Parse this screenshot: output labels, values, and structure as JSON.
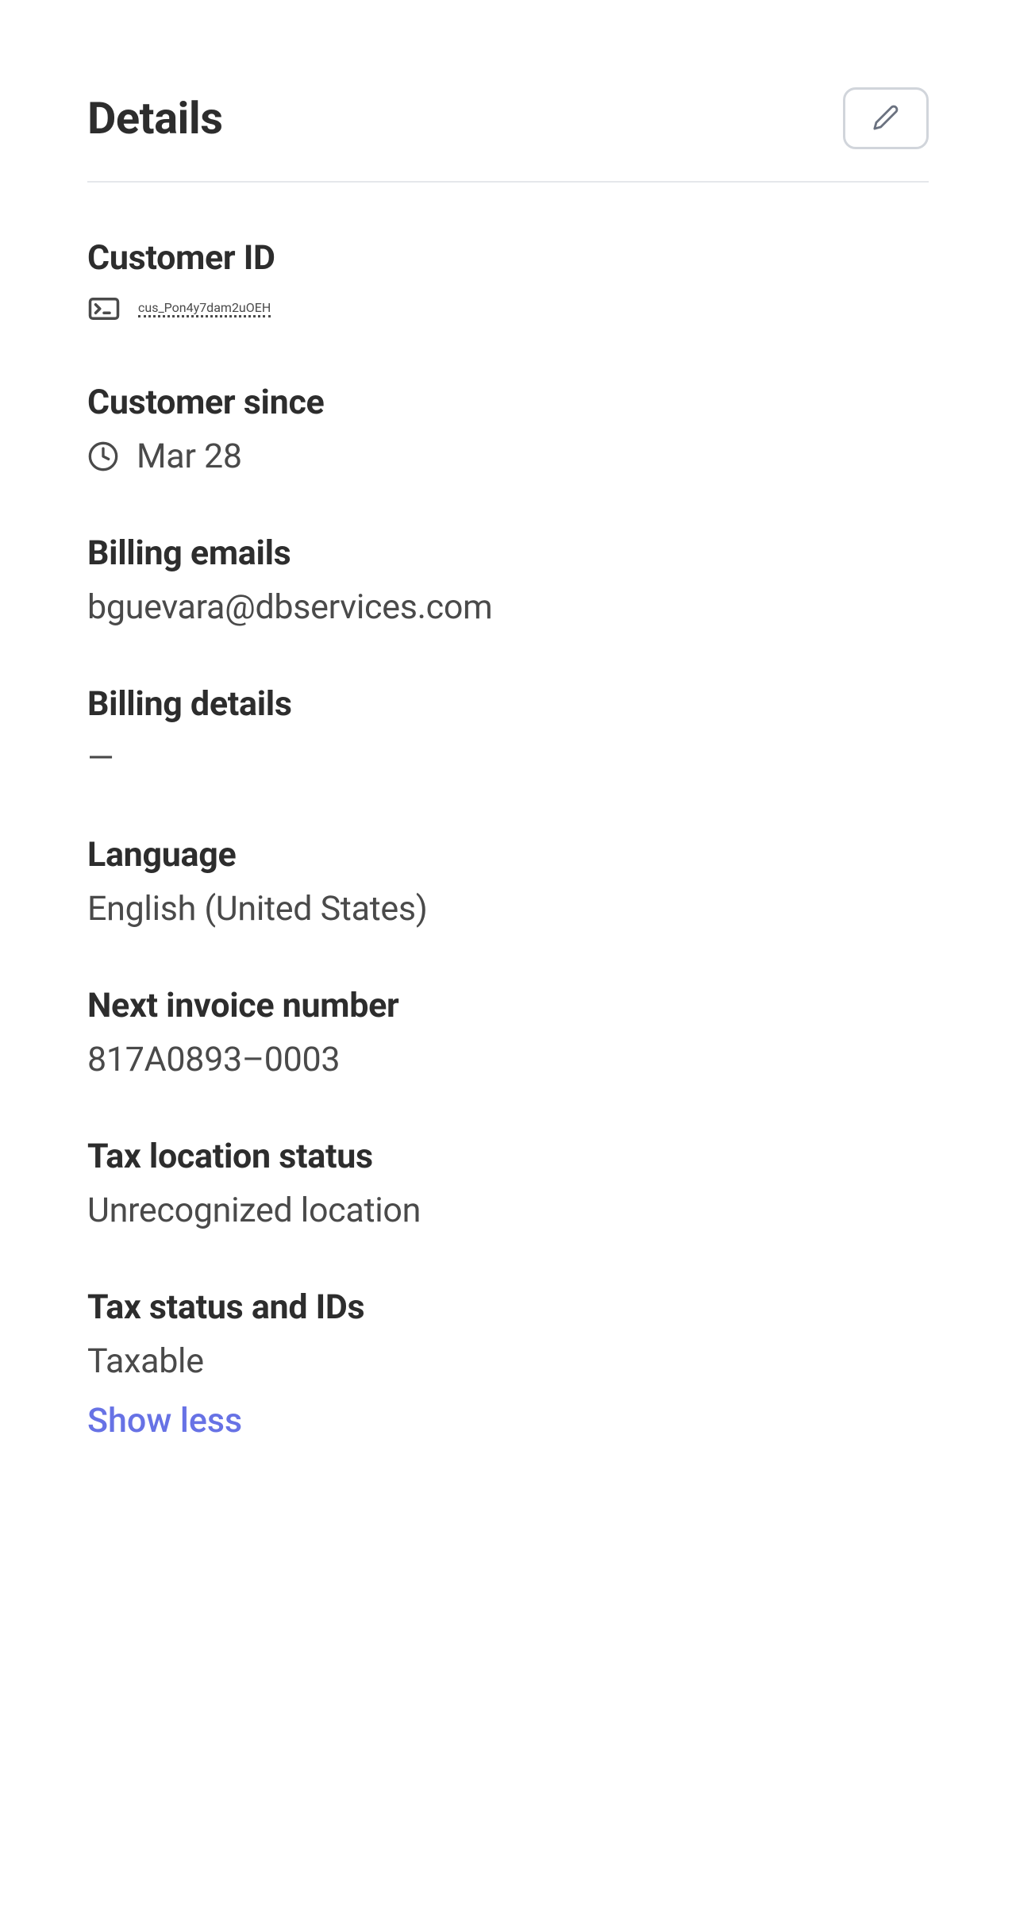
{
  "header": {
    "title": "Details"
  },
  "fields": {
    "customerId": {
      "label": "Customer ID",
      "value": "cus_Pon4y7dam2uOEH"
    },
    "customerSince": {
      "label": "Customer since",
      "value": "Mar 28"
    },
    "billingEmails": {
      "label": "Billing emails",
      "value": "bguevara@dbservices.com"
    },
    "billingDetails": {
      "label": "Billing details",
      "value": "—"
    },
    "language": {
      "label": "Language",
      "value": "English (United States)"
    },
    "nextInvoiceNumber": {
      "label": "Next invoice number",
      "value": "817A0893–0003"
    },
    "taxLocationStatus": {
      "label": "Tax location status",
      "value": "Unrecognized location"
    },
    "taxStatusAndIds": {
      "label": "Tax status and IDs",
      "value": "Taxable"
    }
  },
  "actions": {
    "showLess": "Show less"
  }
}
